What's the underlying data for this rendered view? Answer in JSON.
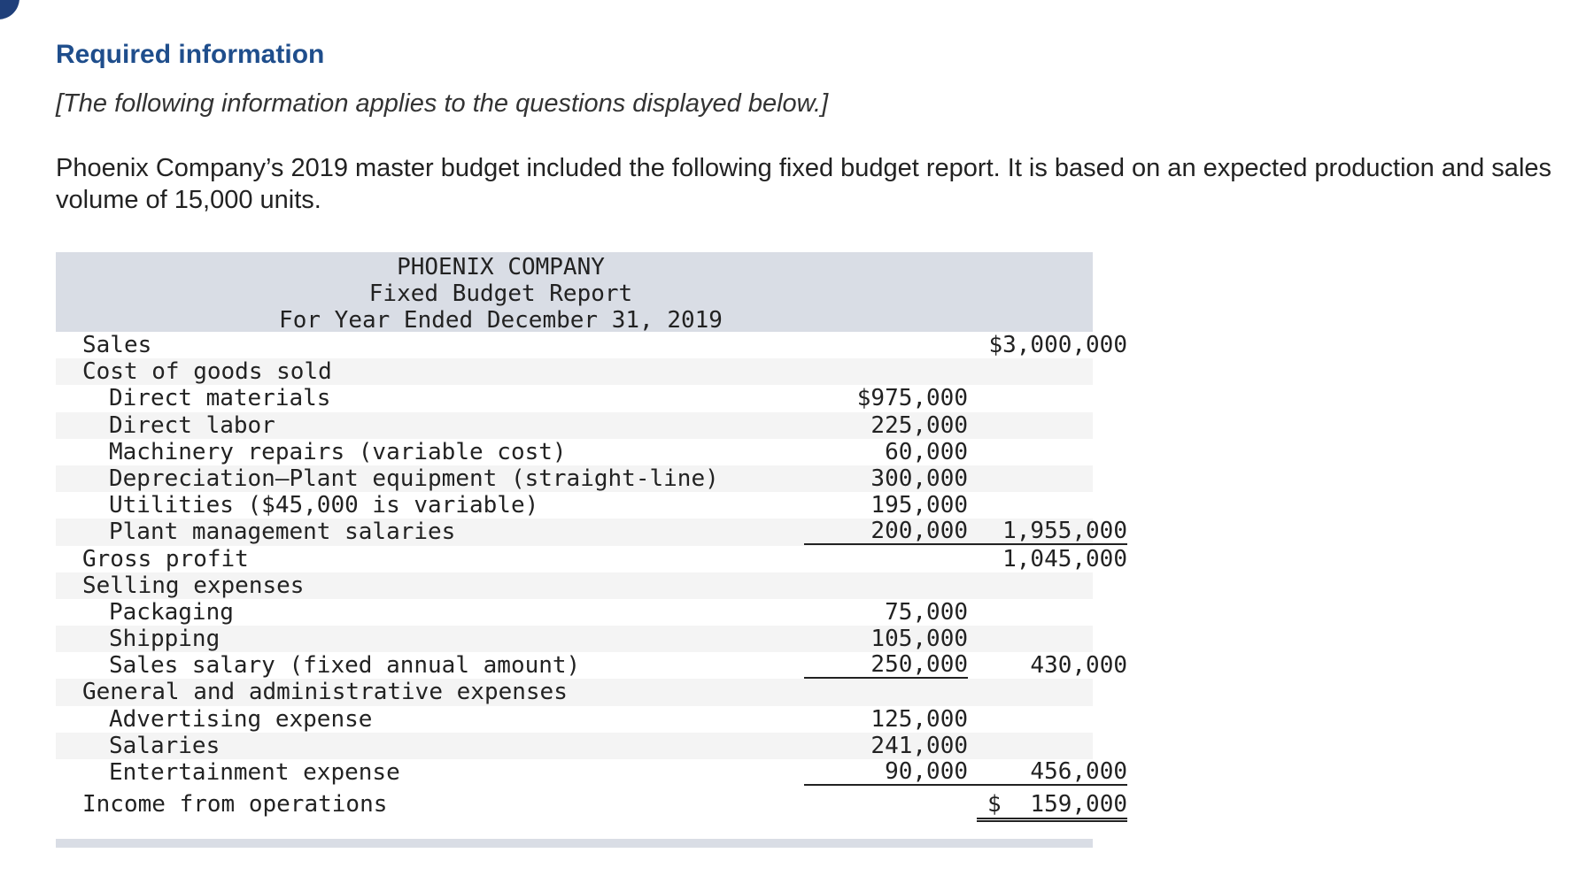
{
  "header": {
    "title": "Required information",
    "note": "[The following information applies to the questions displayed below.]",
    "intro": "Phoenix Company’s 2019 master budget included the following fixed budget report. It is based on an expected production and sales volume of 15,000 units."
  },
  "report": {
    "company": "PHOENIX COMPANY",
    "name": "Fixed Budget Report",
    "period": "For Year Ended December 31, 2019",
    "rows": [
      {
        "label": "Sales",
        "indent": 0,
        "c1": "",
        "c2": "$3,000,000",
        "c1_ul": false,
        "c2_ul": false
      },
      {
        "label": "Cost of goods sold",
        "indent": 0,
        "c1": "",
        "c2": "",
        "c1_ul": false,
        "c2_ul": false
      },
      {
        "label": "Direct materials",
        "indent": 1,
        "c1": "$975,000",
        "c2": "",
        "c1_ul": false,
        "c2_ul": false
      },
      {
        "label": "Direct labor",
        "indent": 1,
        "c1": "225,000",
        "c2": "",
        "c1_ul": false,
        "c2_ul": false
      },
      {
        "label": "Machinery repairs (variable cost)",
        "indent": 1,
        "c1": "60,000",
        "c2": "",
        "c1_ul": false,
        "c2_ul": false
      },
      {
        "label": "Depreciation–Plant equipment (straight-line)",
        "indent": 1,
        "c1": "300,000",
        "c2": "",
        "c1_ul": false,
        "c2_ul": false
      },
      {
        "label": "Utilities ($45,000 is variable)",
        "indent": 1,
        "c1": "195,000",
        "c2": "",
        "c1_ul": false,
        "c2_ul": false
      },
      {
        "label": "Plant management salaries",
        "indent": 1,
        "c1": "200,000",
        "c2": "1,955,000",
        "c1_ul": true,
        "c2_ul": true
      },
      {
        "label": "Gross profit",
        "indent": 0,
        "c1": "",
        "c2": "1,045,000",
        "c1_ul": false,
        "c2_ul": false
      },
      {
        "label": "Selling expenses",
        "indent": 0,
        "c1": "",
        "c2": "",
        "c1_ul": false,
        "c2_ul": false
      },
      {
        "label": "Packaging",
        "indent": 1,
        "c1": "75,000",
        "c2": "",
        "c1_ul": false,
        "c2_ul": false
      },
      {
        "label": "Shipping",
        "indent": 1,
        "c1": "105,000",
        "c2": "",
        "c1_ul": false,
        "c2_ul": false
      },
      {
        "label": "Sales salary (fixed annual amount)",
        "indent": 1,
        "c1": "250,000",
        "c2": "430,000",
        "c1_ul": true,
        "c2_ul": false
      },
      {
        "label": "General and administrative expenses",
        "indent": 0,
        "c1": "",
        "c2": "",
        "c1_ul": false,
        "c2_ul": false
      },
      {
        "label": "Advertising expense",
        "indent": 1,
        "c1": "125,000",
        "c2": "",
        "c1_ul": false,
        "c2_ul": false
      },
      {
        "label": "Salaries",
        "indent": 1,
        "c1": "241,000",
        "c2": "",
        "c1_ul": false,
        "c2_ul": false
      },
      {
        "label": "Entertainment expense",
        "indent": 1,
        "c1": "90,000",
        "c2": "456,000",
        "c1_ul": true,
        "c2_ul": true
      }
    ],
    "final": {
      "label": "Income from operations",
      "dollar": "$",
      "value": "159,000"
    }
  }
}
